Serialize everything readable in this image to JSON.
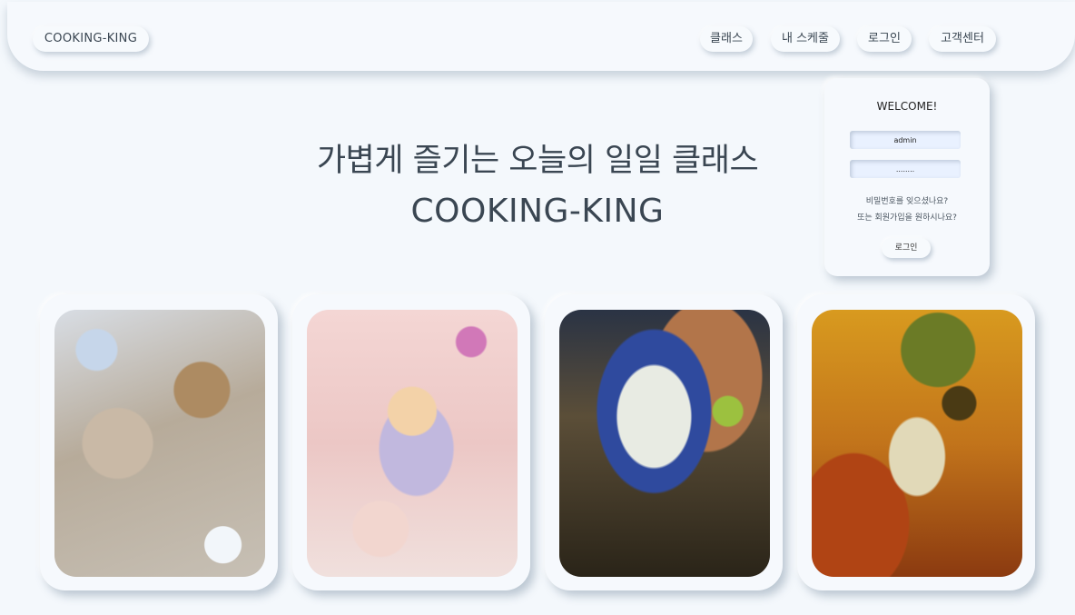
{
  "nav": {
    "brand": "COOKING-KING",
    "items": [
      {
        "label": "클래스"
      },
      {
        "label": "내 스케줄"
      },
      {
        "label": "로그인"
      },
      {
        "label": "고객센터"
      }
    ]
  },
  "hero": {
    "headline": "가볍게 즐기는 오늘의 일일 클래스",
    "title": "COOKING-KING"
  },
  "login": {
    "title": "WELCOME!",
    "username_value": "admin",
    "password_value": "........",
    "forgot_link": "비밀번호를 잊으셨나요?",
    "signup_link": "또는 회원가입을 원하시나요?",
    "button_label": "로그인"
  },
  "gallery": {
    "cards": [
      {
        "image": "party-table-photo"
      },
      {
        "image": "unicorn-dessert-table-photo"
      },
      {
        "image": "margarita-cocktail-photo"
      },
      {
        "image": "wine-glasses-photo"
      }
    ]
  }
}
